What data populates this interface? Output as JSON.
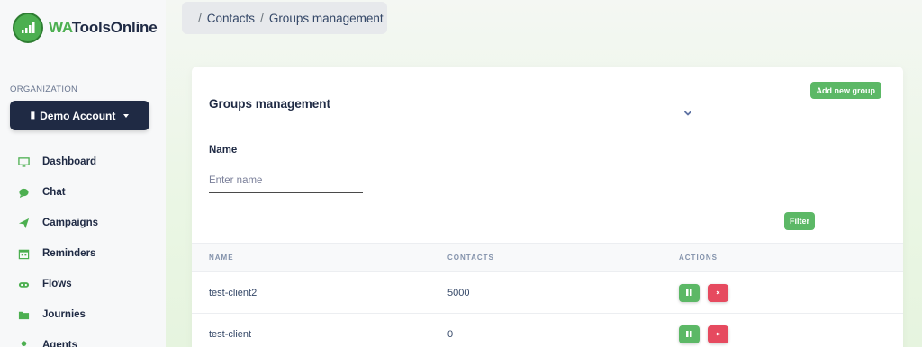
{
  "brand": {
    "prefix": "WA",
    "suffix": "ToolsOnline"
  },
  "sidebar": {
    "org_label": "ORGANIZATION",
    "account_label": "Demo Account",
    "items": [
      {
        "label": "Dashboard",
        "icon": "monitor-icon"
      },
      {
        "label": "Chat",
        "icon": "chat-bubble-icon"
      },
      {
        "label": "Campaigns",
        "icon": "paper-plane-icon"
      },
      {
        "label": "Reminders",
        "icon": "calendar-icon"
      },
      {
        "label": "Flows",
        "icon": "gamepad-icon"
      },
      {
        "label": "Journies",
        "icon": "folder-icon"
      },
      {
        "label": "Agents",
        "icon": "user-icon"
      }
    ]
  },
  "breadcrumb": {
    "separator": "/",
    "parent": "Contacts",
    "current": "Groups management"
  },
  "card": {
    "title": "Groups management",
    "add_button": "Add new group",
    "filter": {
      "label": "Name",
      "placeholder": "Enter name",
      "button": "Filter"
    }
  },
  "table": {
    "headers": [
      "NAME",
      "CONTACTS",
      "ACTIONS"
    ],
    "rows": [
      {
        "name": "test-client2",
        "contacts": "5000"
      },
      {
        "name": "test-client",
        "contacts": "0"
      }
    ]
  },
  "colors": {
    "accent": "#5cb866",
    "danger": "#e64a5f",
    "dark": "#1f2a44"
  }
}
